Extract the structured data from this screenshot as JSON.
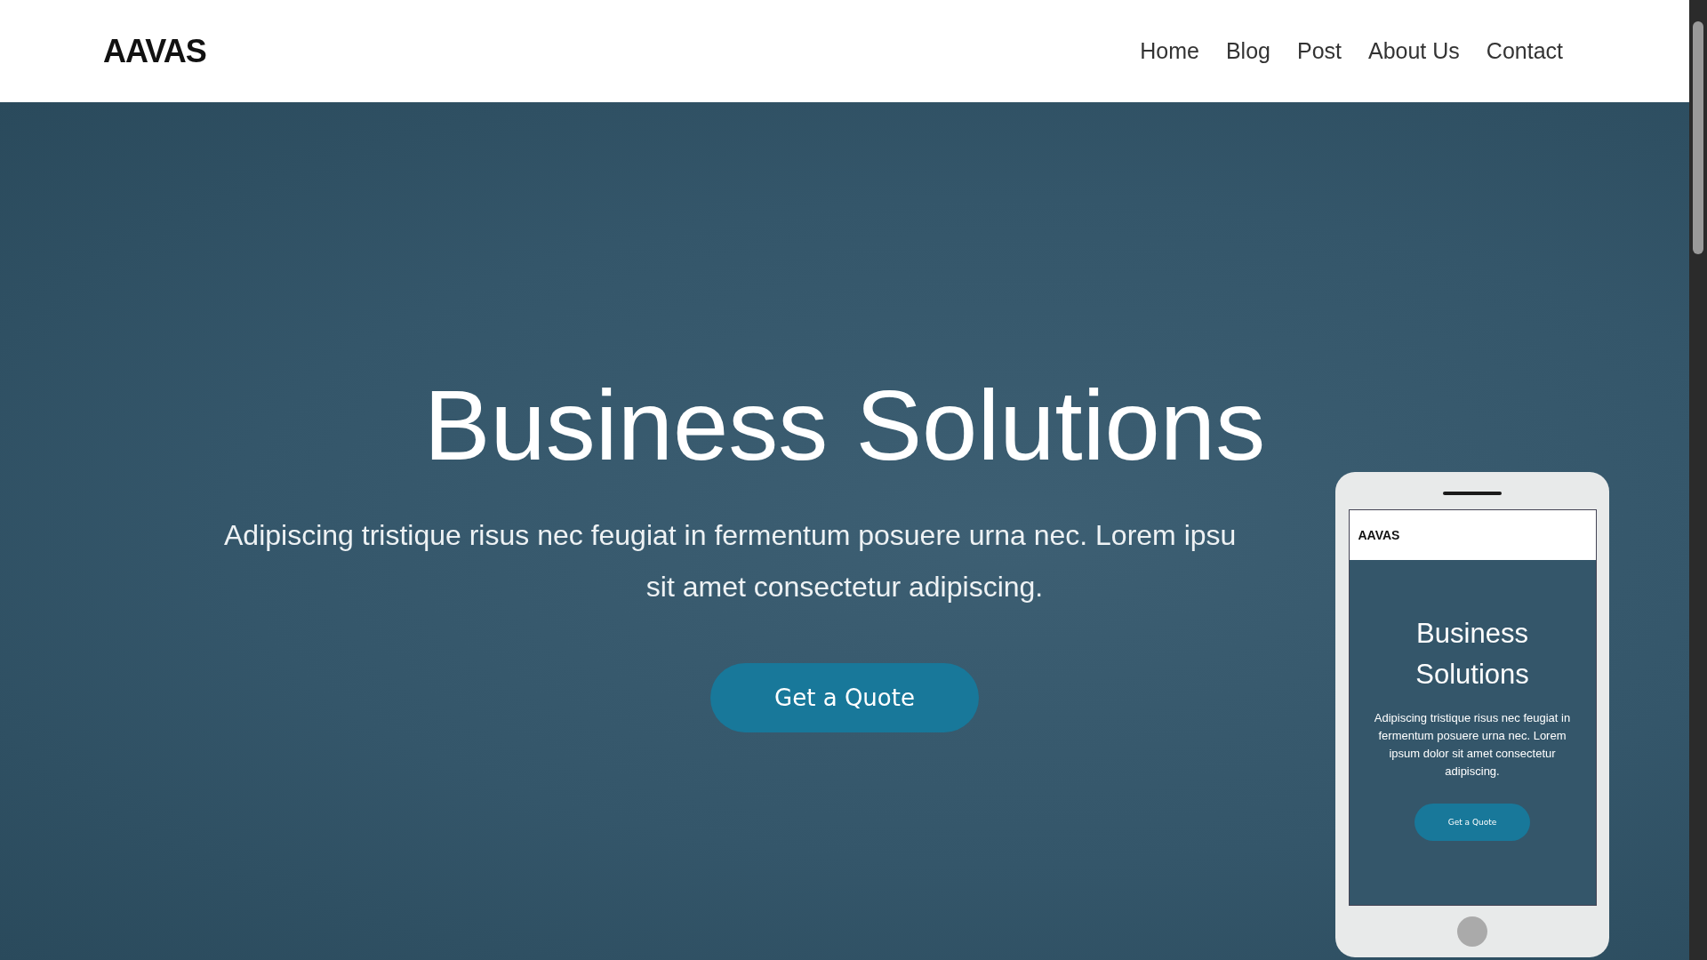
{
  "header": {
    "logo": "AAVAS",
    "nav": [
      {
        "label": "Home"
      },
      {
        "label": "Blog"
      },
      {
        "label": "Post"
      },
      {
        "label": "About Us"
      },
      {
        "label": "Contact"
      }
    ]
  },
  "hero": {
    "title": "Business Solutions",
    "text_lines": [
      "Adipiscing tristique risus nec feugiat in fermentum posuere urna nec. Lorem ipsu",
      "sit amet consectetur adipiscing."
    ],
    "button": "Get a Quote"
  },
  "phone_preview": {
    "logo": "AAVAS",
    "title": "Business Solutions",
    "text": "Adipiscing tristique risus nec feugiat in fermentum posuere urna nec. Lorem ipsum dolor sit amet consectetur adipiscing.",
    "button": "Get a Quote"
  }
}
